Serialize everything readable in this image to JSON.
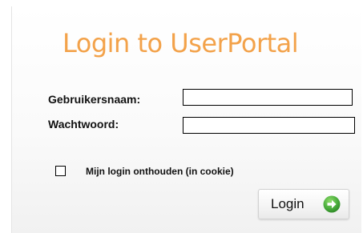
{
  "title": "Login to UserPortal",
  "username": {
    "label": "Gebruikersnaam:",
    "value": ""
  },
  "password": {
    "label": "Wachtwoord:",
    "value": ""
  },
  "remember": {
    "label": "Mijn login onthouden (in cookie)",
    "checked": false
  },
  "login_button": {
    "label": "Login",
    "icon": "arrow-right-circle-icon"
  },
  "colors": {
    "title": "#f3a24a",
    "arrow_icon": "#4caf3e"
  }
}
